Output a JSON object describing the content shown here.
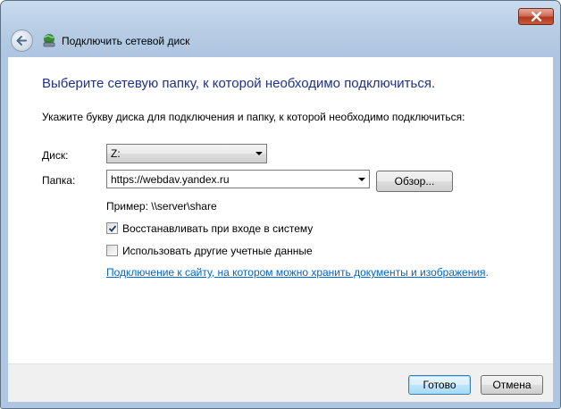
{
  "window": {
    "nav_title": "Подключить сетевой диск"
  },
  "main": {
    "heading": "Выберите сетевую папку, к которой необходимо подключиться.",
    "instruction": "Укажите букву диска для подключения и папку, к которой необходимо подключиться:",
    "drive_label": "Диск:",
    "drive_value": "Z:",
    "folder_label": "Папка:",
    "folder_value": "https://webdav.yandex.ru",
    "browse_label": "Обзор...",
    "example_text": "Пример: \\\\server\\share",
    "reconnect_label": "Восстанавливать при входе в систему",
    "reconnect_checked": true,
    "other_credentials_label": "Использовать другие учетные данные",
    "other_credentials_checked": false,
    "link_text": "Подключение к сайту, на котором можно хранить документы и изображения",
    "link_suffix": "."
  },
  "footer": {
    "finish_label": "Готово",
    "cancel_label": "Отмена"
  },
  "icons": {
    "close": "close-icon",
    "back": "back-arrow-icon",
    "network_drive": "network-drive-icon",
    "dropdown": "chevron-down-icon",
    "check": "checkmark-icon"
  },
  "colors": {
    "heading": "#1e3287",
    "link": "#0066cc",
    "close_button": "#c95a3a"
  }
}
